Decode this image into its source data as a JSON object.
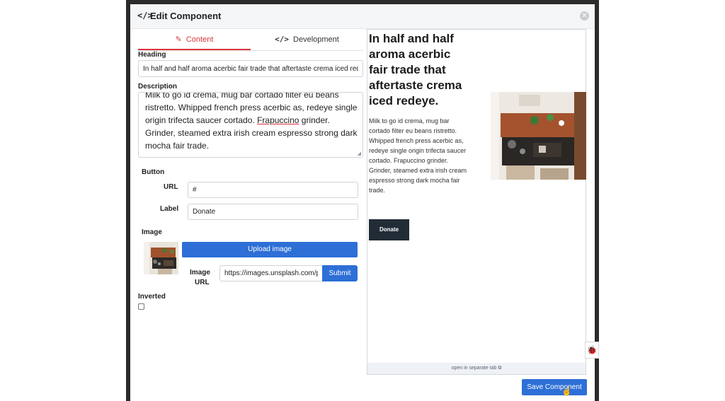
{
  "dialog": {
    "title": "Edit Component"
  },
  "tabs": [
    {
      "label": "Content",
      "icon": "edit-icon",
      "active": true
    },
    {
      "label": "Development",
      "icon": "code-icon",
      "active": false
    }
  ],
  "form": {
    "heading_label": "Heading",
    "heading_value": "In half and half aroma acerbic fair trade that aftertaste crema iced rede",
    "description_label": "Description",
    "description_value_before": "Milk to go id crema, mug bar cortado filter eu beans ristretto. Whipped french press acerbic as, redeye single origin trifecta saucer cortado. ",
    "description_value_spell": "Frapuccino",
    "description_value_after": " grinder. Grinder, steamed extra irish cream espresso strong dark mocha fair trade.",
    "button_section_label": "Button",
    "url_label": "URL",
    "url_value": "#",
    "label_label": "Label",
    "label_value": "Donate",
    "image_section_label": "Image",
    "upload_button": "Upload image",
    "image_url_label_1": "Image",
    "image_url_label_2": "URL",
    "image_url_value": "https://images.unsplash.com/p",
    "submit_button": "Submit",
    "inverted_label": "Inverted",
    "inverted_checked": false
  },
  "preview": {
    "heading": "In half and half aroma acerbic fair trade that aftertaste crema iced redeye.",
    "description": "Milk to go id crema, mug bar cortado filter eu beans ristretto. Whipped french press acerbic as, redeye single origin trifecta saucer cortado. Frapuccino grinder. Grinder, steamed extra irish cream espresso strong dark mocha fair trade.",
    "button_label": "Donate",
    "open_link": "open in separate tab"
  },
  "footer": {
    "save_button": "Save Component"
  },
  "colors": {
    "accent_blue": "#2d6fd6",
    "active_tab_red": "#d9363e",
    "preview_button": "#222c37"
  }
}
